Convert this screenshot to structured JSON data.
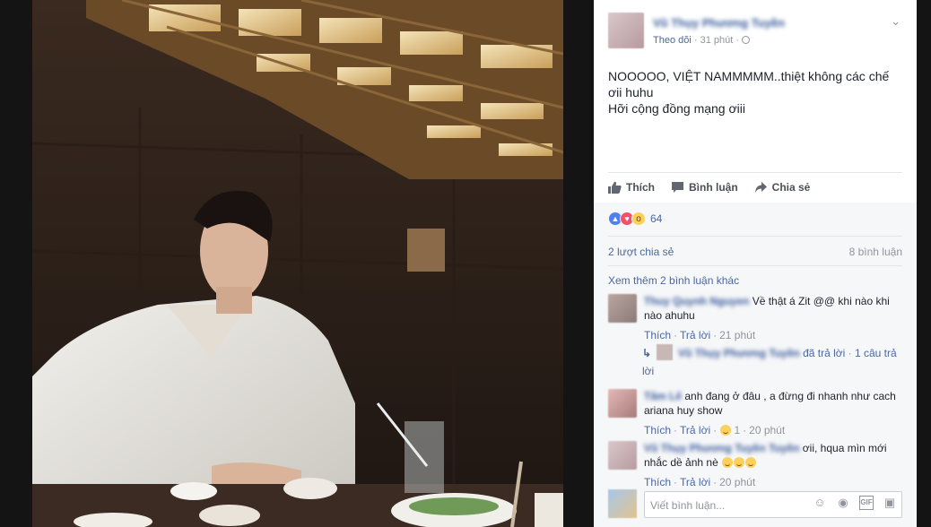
{
  "post": {
    "author": "Vũ Thụy Phương Tuyền",
    "follow": "Theo dõi",
    "time": "31 phút",
    "lines": [
      "NOOOOO, VIỆT NAMMMMM..thiệt không các chế",
      "ơii huhu",
      "Hỡi cộng đồng mạng ơiii"
    ]
  },
  "actions": {
    "like": "Thích",
    "comment": "Bình luận",
    "share": "Chia sẻ"
  },
  "reactions": {
    "count": "64"
  },
  "stats": {
    "shares": "2 lượt chia sẻ",
    "comments": "8 bình luận"
  },
  "more_comments": "Xem thêm 2 bình luận khác",
  "comments": [
    {
      "name": "Thuy Quynh Nguyen",
      "text": "Về thật á Zit @@ khi nào khi nào ahuhu",
      "like": "Thích",
      "reply": "Trả lời",
      "time": "21 phút"
    },
    {
      "name": "Tâm Lê",
      "text": "anh đang ở đâu , a đừng đi nhanh như cach ariana huy show",
      "like": "Thích",
      "reply": "Trả lời",
      "reaction_count": "1",
      "time": "20 phút"
    },
    {
      "name": "Vũ Thụy Phương Tuyền Tuyền",
      "text": "ơii, hqua mìn mới nhắc dề ảnh nè",
      "like": "Thích",
      "reply": "Trả lời",
      "time": "20 phút"
    }
  ],
  "reply_thread": {
    "name": "Vũ Thụy Phương Tuyền",
    "action": "đã trả lời",
    "count": "1 câu trả lời"
  },
  "composer": {
    "placeholder": "Viết bình luận..."
  },
  "colors": {
    "link": "#365899",
    "accent": "#4b67a1",
    "muted": "#90949c"
  }
}
